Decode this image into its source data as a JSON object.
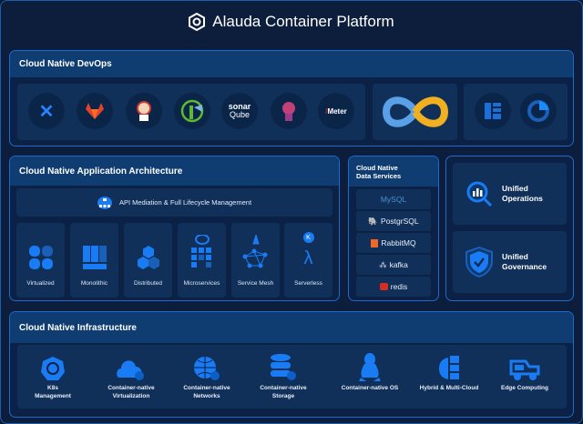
{
  "header": {
    "title": "Alauda Container Platform"
  },
  "devops": {
    "title": "Cloud Native DevOps",
    "tools": [
      "Jira",
      "GitLab",
      "Jenkins",
      "Harbor",
      "sonar Qube",
      "Kubeflow",
      "JMeter"
    ],
    "sonar_top": "sonar",
    "sonar_bottom": "Qube",
    "jmeter": "Meter"
  },
  "app": {
    "title": "Cloud Native Application Architecture",
    "api": "API Mediation & Full Lifecycle Management",
    "cards": [
      "Virtualized",
      "Monolithic",
      "Distributed",
      "Microservices",
      "Service Mesh",
      "Serverless"
    ]
  },
  "data": {
    "title_line1": "Cloud Native",
    "title_line2": "Data Services",
    "items": [
      "MySQL",
      "PostgrSQL",
      "RabbitMQ",
      "kafka",
      "redis"
    ]
  },
  "unified": {
    "ops_line1": "Unified",
    "ops_line2": "Operations",
    "gov_line1": "Unified",
    "gov_line2": "Governance"
  },
  "infra": {
    "title": "Cloud Native Infrastructure",
    "items": [
      [
        "K8s",
        "Management"
      ],
      [
        "Container-native",
        "Virtualization"
      ],
      [
        "Container-native",
        "Networks"
      ],
      [
        "Container-native",
        "Storage"
      ],
      [
        "Container-native OS",
        ""
      ],
      [
        "Hybrid & Multi-Cloud",
        ""
      ],
      [
        "Edge Computing",
        ""
      ]
    ]
  },
  "colors": {
    "accent": "#1a7cf5",
    "border": "#1d6ad0",
    "header": "#0f3d72"
  }
}
